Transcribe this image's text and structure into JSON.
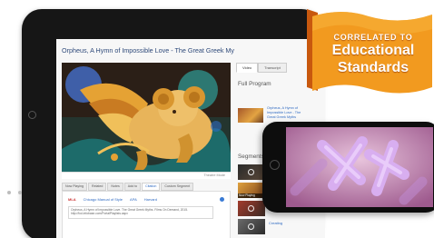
{
  "video": {
    "title": "Orpheus, A Hymn of Impossible Love - The Great Greek Myths",
    "player_note": "Theatre Mode"
  },
  "player_tabs": [
    {
      "label": "Now Playing"
    },
    {
      "label": "Related"
    },
    {
      "label": "Notes"
    },
    {
      "label": "Add to"
    },
    {
      "label": "Citation"
    },
    {
      "label": "Custom Segment"
    }
  ],
  "citation": {
    "styles": [
      {
        "label": "MLA"
      },
      {
        "label": "Chicago Manual of Style"
      },
      {
        "label": "APA"
      },
      {
        "label": "Harvard"
      }
    ],
    "text": "Orpheus, A Hymn of Impossible Love. The Great Greek Myths. Films On Demand, 2015. http://fod.infobase.com/PortalPlaylists.aspx"
  },
  "sidebar": {
    "tabs": [
      {
        "label": "Video"
      },
      {
        "label": "Transcript"
      }
    ],
    "full_program_heading": "Full Program",
    "full_program_link": "Orpheus, A Hymn of Impossible Love - The Great Greek Myths",
    "segments_heading": "Segments",
    "now_playing_label": "Now Playing",
    "segment_link": "Creating"
  },
  "banner": {
    "line1": "CORRELATED TO",
    "line2": "Educational",
    "line3": "Standards"
  },
  "colors": {
    "banner_orange": "#f29a1f",
    "banner_dark": "#c8580e",
    "link_blue": "#2f6ac2",
    "title_blue": "#2f4a7a"
  }
}
